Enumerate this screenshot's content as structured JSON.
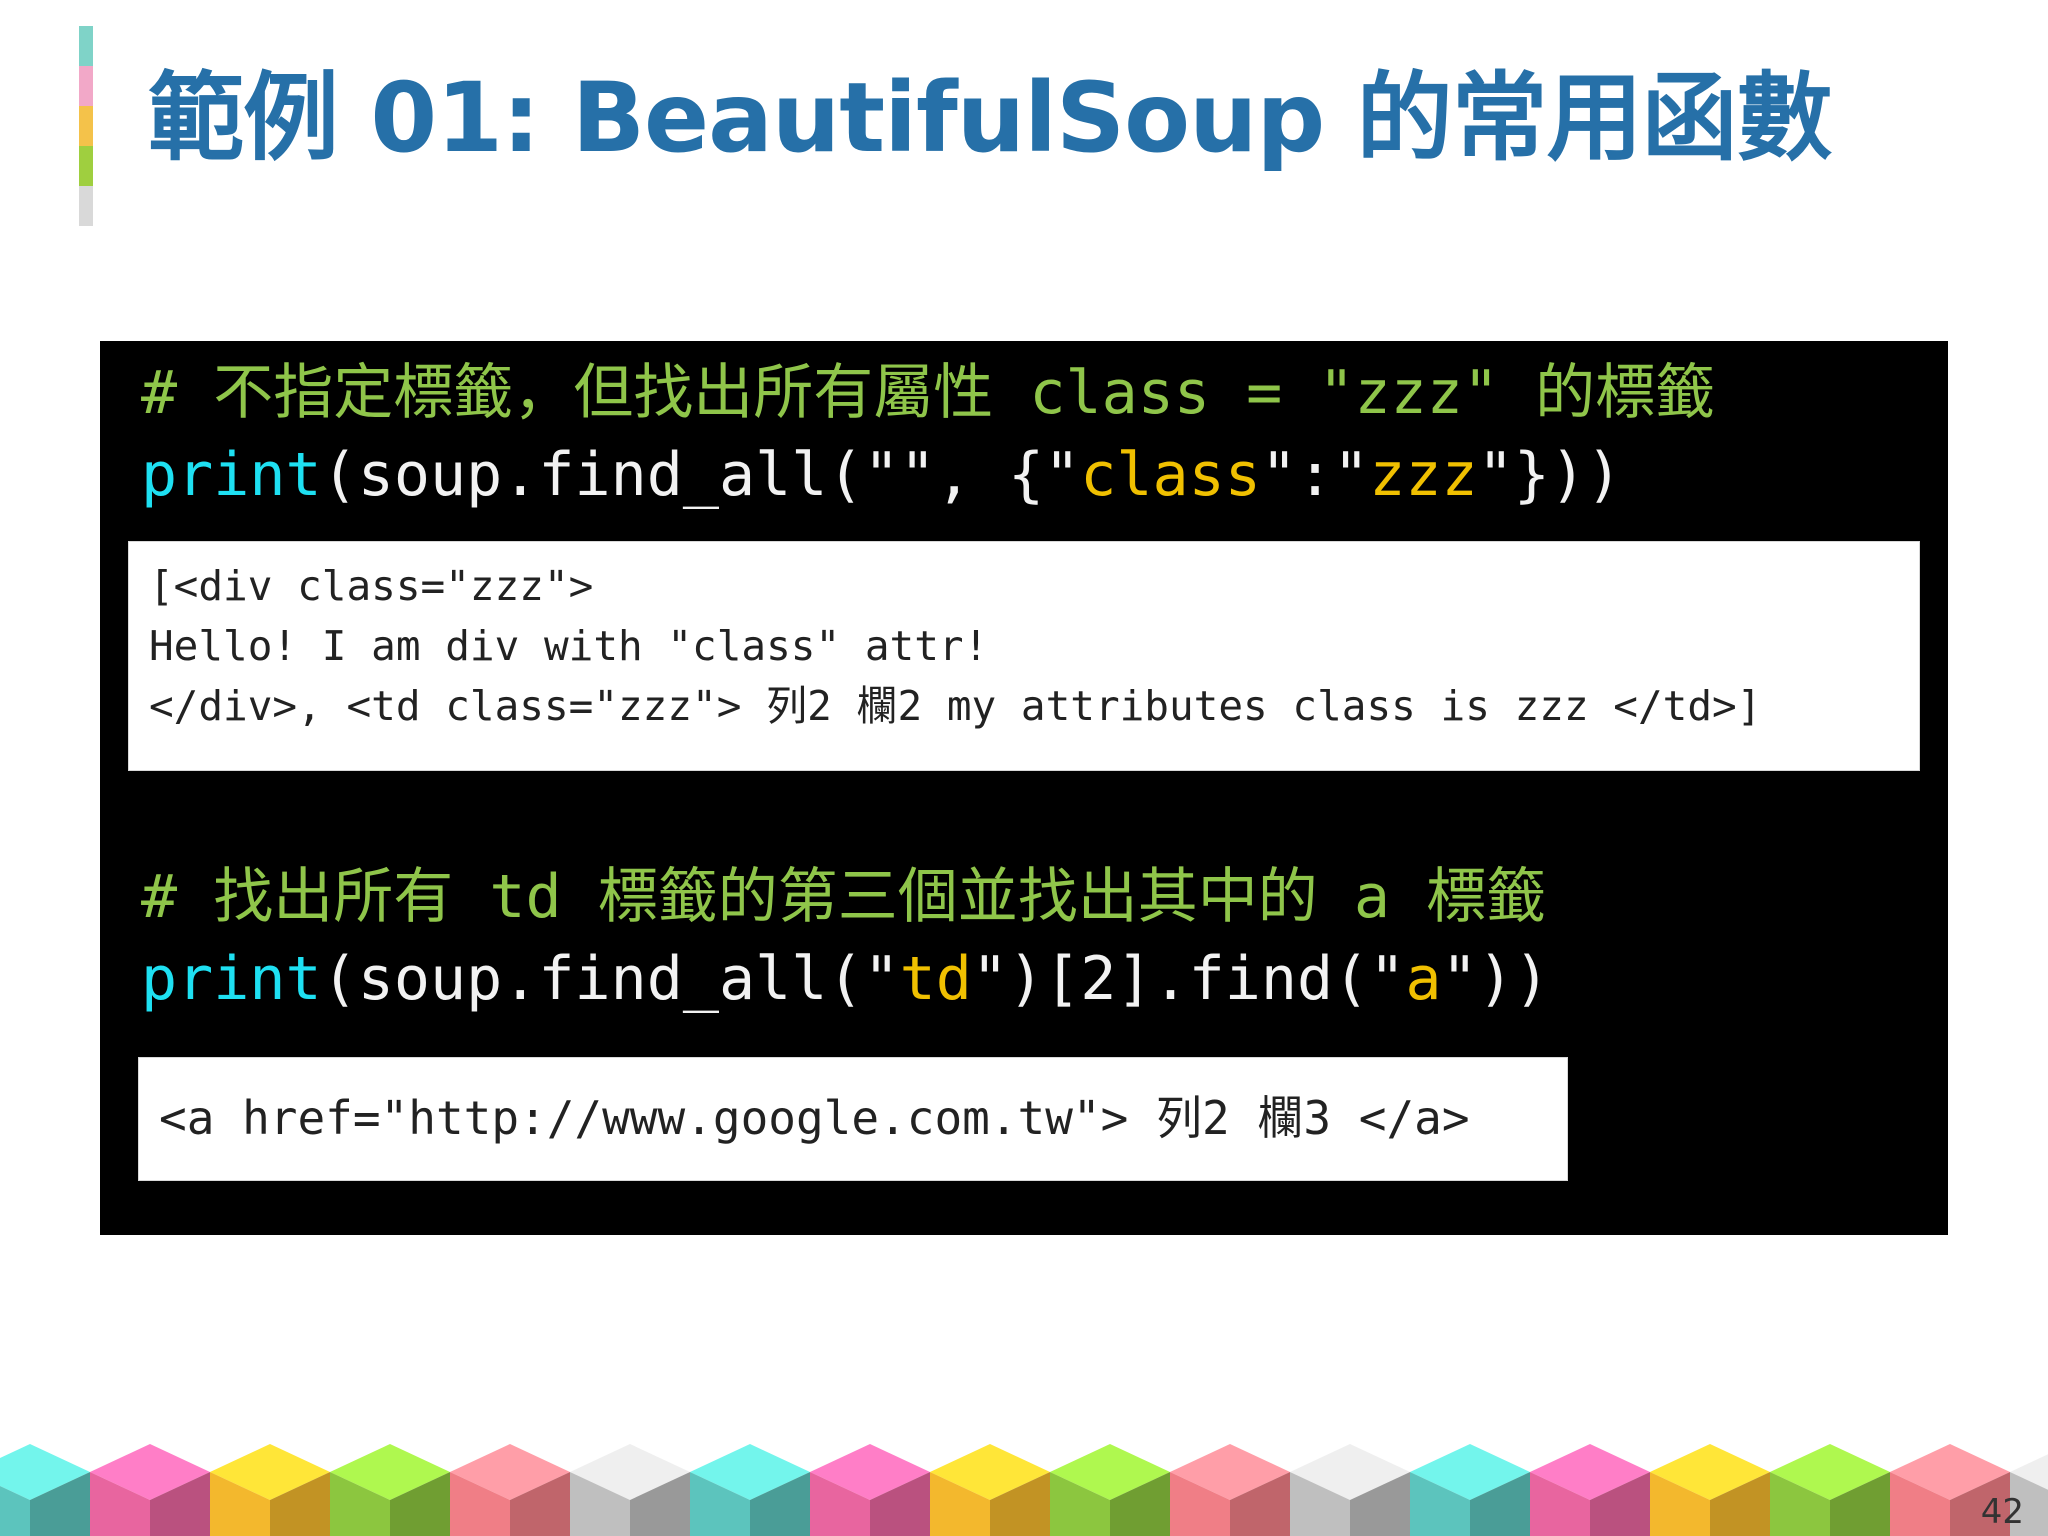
{
  "slide": {
    "title": "範例 01: BeautifulSoup 的常用函數",
    "page_number": "42"
  },
  "colors": {
    "title": "#2670a8",
    "code_background": "#000000",
    "comment": "#8fc54a",
    "function": "#1ee0f2",
    "string": "#f0c000",
    "accent_bar": [
      "#7fd3c8",
      "#f2a8c8",
      "#f4c24a",
      "#9fcf3f",
      "#d9d9d9"
    ],
    "cubes": [
      "#5cc4bd",
      "#e8659f",
      "#f3b82d",
      "#8cc63f",
      "#f07e86",
      "#bfbfbf"
    ]
  },
  "example1": {
    "comment": "# 不指定標籤，但找出所有屬性 class = \"zzz\" 的標籤",
    "code": {
      "fn": "print",
      "p1": "(soup.find_all(\"\", {\"",
      "s1": "class",
      "p2": "\":\"",
      "s2": "zzz",
      "p3": "\"}))"
    },
    "output": [
      "[<div class=\"zzz\">",
      "Hello! I am div with \"class\" attr!",
      "</div>, <td class=\"zzz\"> 列2 欄2 my attributes class is zzz </td>]"
    ]
  },
  "example2": {
    "comment": "# 找出所有 td 標籤的第三個並找出其中的 a 標籤",
    "code": {
      "fn": "print",
      "p1": "(soup.find_all(\"",
      "s1": "td",
      "p2": "\")[2].find(\"",
      "s2": "a",
      "p3": "\"))"
    },
    "output": [
      "<a href=\"http://www.google.com.tw\"> 列2 欄3 </a>"
    ]
  }
}
